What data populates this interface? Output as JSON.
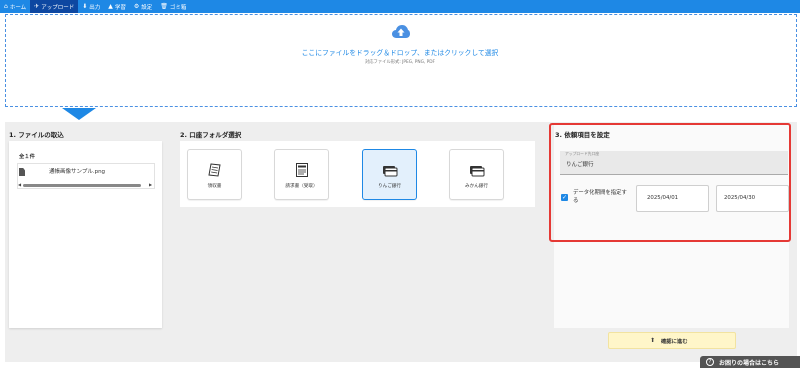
{
  "nav": {
    "items": [
      {
        "icon": "home-icon",
        "glyph": "⌂",
        "label": "ホーム"
      },
      {
        "icon": "paper-plane-icon",
        "glyph": "✈",
        "label": "アップロード"
      },
      {
        "icon": "download-icon",
        "glyph": "⬇",
        "label": "出力"
      },
      {
        "icon": "graduation-cap-icon",
        "glyph": "▲",
        "label": "学習"
      },
      {
        "icon": "gear-icon",
        "glyph": "⚙",
        "label": "設定"
      },
      {
        "icon": "trash-icon",
        "glyph": "🗑",
        "label": "ゴミ箱"
      }
    ],
    "active_index": 1
  },
  "upload": {
    "text": "ここにファイルをドラッグ＆ドロップ、またはクリックして選択",
    "subtext": "対応ファイル形式: JPEG, PNG, PDF"
  },
  "section1": {
    "title": "1. ファイルの取込",
    "count": "全１件",
    "file_name": "通帳画像サンプル.png"
  },
  "section2": {
    "title": "2. 口座フォルダ選択",
    "tiles": [
      {
        "label": "領収書",
        "icon": "receipt-icon"
      },
      {
        "label": "請求書（受取）",
        "icon": "invoice-icon"
      },
      {
        "label": "りんご銀行",
        "icon": "bank-card-icon"
      },
      {
        "label": "みかん銀行",
        "icon": "bank-card-icon"
      }
    ],
    "selected_index": 2
  },
  "section3": {
    "title": "3. 依頼項目を設定",
    "folder_label": "アップロード先口座",
    "folder_value": "りんご銀行",
    "period_checkbox_label": "データ化期間を指定する",
    "period_checked": true,
    "date_from": "2025/04/01",
    "date_to": "2025/04/30"
  },
  "confirm": {
    "label": "確認に進む"
  },
  "help": {
    "label": "お困りの場合はこちら"
  },
  "colors": {
    "accent": "#1e88e5",
    "highlight": "#e53935",
    "confirm_bg": "#fff6c9"
  }
}
